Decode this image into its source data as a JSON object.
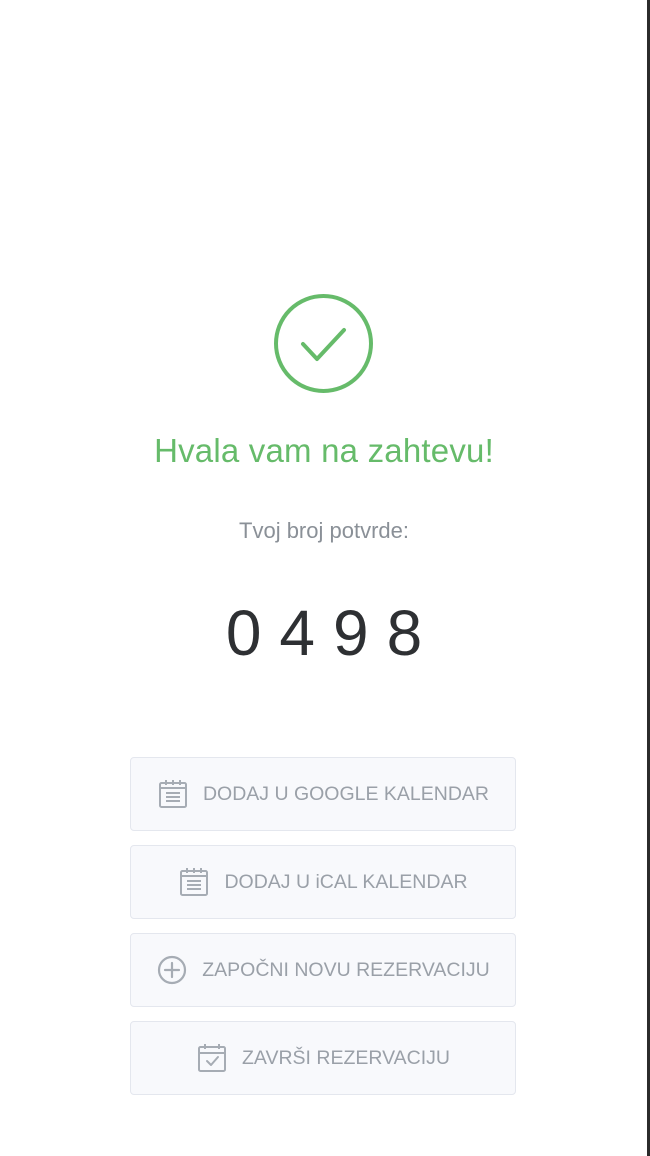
{
  "confirmation": {
    "title": "Hvala vam na zahtevu!",
    "subtitle": "Tvoj broj potvrde:",
    "code": "0498"
  },
  "actions": [
    {
      "label": "DODAJ U GOOGLE KALENDAR",
      "icon": "calendar-icon"
    },
    {
      "label": "DODAJ U iCAL KALENDAR",
      "icon": "calendar-icon"
    },
    {
      "label": "ZAPOČNI NOVU REZERVACIJU",
      "icon": "plus-circle-icon"
    },
    {
      "label": "ZAVRŠI REZERVACIJU",
      "icon": "calendar-check-icon"
    }
  ],
  "colors": {
    "accent": "#66bb6a",
    "muted_text": "#9aa0a8",
    "button_bg": "#f8f9fc",
    "button_border": "#e4e7ee",
    "code_text": "#2e3033"
  }
}
